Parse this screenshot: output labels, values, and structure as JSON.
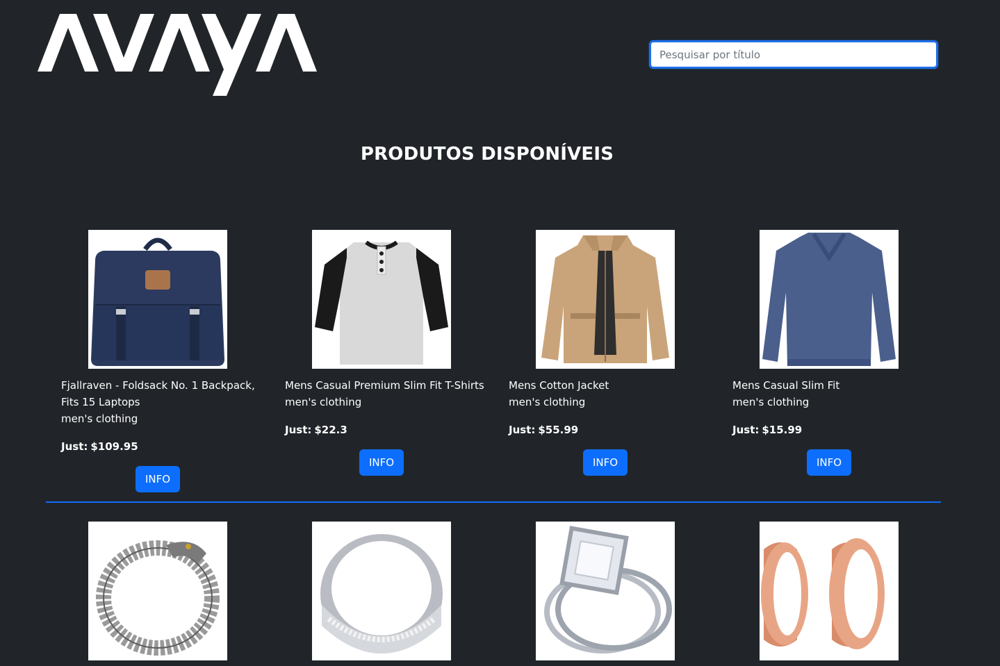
{
  "header": {
    "logo_text": "AVAYA",
    "search_placeholder": "Pesquisar por título",
    "search_value": ""
  },
  "main": {
    "title": "PRODUTOS DISPONÍVEIS",
    "price_prefix": "Just:",
    "products": [
      {
        "title": "Fjallraven - Foldsack No. 1 Backpack, Fits 15 Laptops",
        "category": "men's clothing",
        "price": "$109.95",
        "button": "INFO",
        "image": "backpack"
      },
      {
        "title": "Mens Casual Premium Slim Fit T-Shirts",
        "category": "men's clothing",
        "price": "$22.3",
        "button": "INFO",
        "image": "raglan-tshirt"
      },
      {
        "title": "Mens Cotton Jacket",
        "category": "men's clothing",
        "price": "$55.99",
        "button": "INFO",
        "image": "jacket"
      },
      {
        "title": "Mens Casual Slim Fit",
        "category": "men's clothing",
        "price": "$15.99",
        "button": "INFO",
        "image": "long-sleeve-shirt"
      },
      {
        "image": "dragon-bracelet"
      },
      {
        "image": "silver-ring"
      },
      {
        "image": "diamond-ring-set"
      },
      {
        "image": "rose-gold-plugs"
      }
    ]
  },
  "colors": {
    "background": "#212529",
    "accent": "#0d6efd",
    "text": "#ffffff"
  }
}
